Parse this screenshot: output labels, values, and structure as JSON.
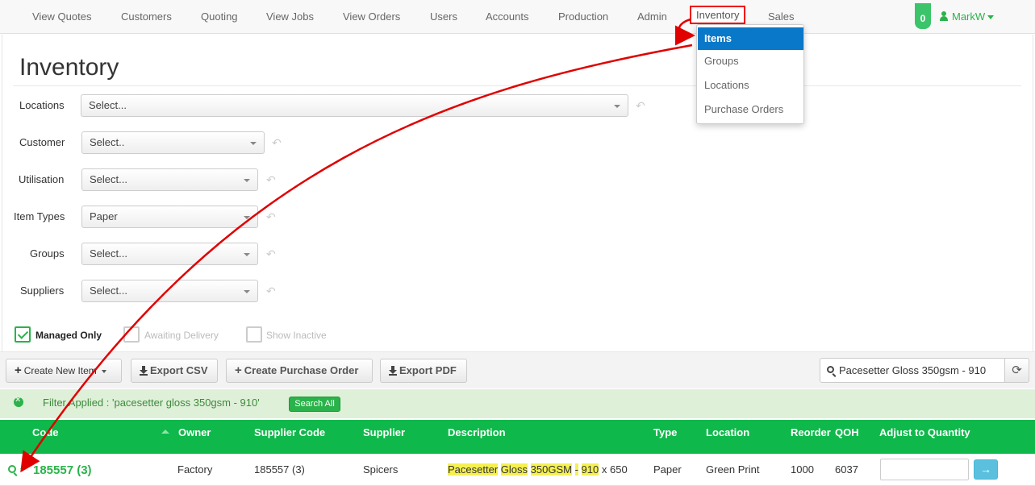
{
  "nav": {
    "items": [
      "View Quotes",
      "Customers",
      "Quoting",
      "View Jobs",
      "View Orders",
      "Users",
      "Accounts",
      "Production",
      "Admin",
      "Inventory",
      "Sales"
    ],
    "notification_count": "0",
    "user_name": "MarkW"
  },
  "dropdown": {
    "items": [
      "Items",
      "Groups",
      "Locations",
      "Purchase Orders"
    ],
    "selected": "Items"
  },
  "page": {
    "title": "Inventory"
  },
  "filters": {
    "locations": {
      "label": "Locations",
      "value": "Select..."
    },
    "customer": {
      "label": "Customer",
      "value": "Select.."
    },
    "utilisation": {
      "label": "Utilisation",
      "value": "Select..."
    },
    "item_types": {
      "label": "Item Types",
      "value": "Paper"
    },
    "groups": {
      "label": "Groups",
      "value": "Select..."
    },
    "suppliers": {
      "label": "Suppliers",
      "value": "Select..."
    }
  },
  "checkboxes": {
    "managed_only": {
      "label": "Managed Only",
      "checked": true
    },
    "awaiting_delivery": {
      "label": "Awaiting Delivery",
      "checked": false
    },
    "show_inactive": {
      "label": "Show Inactive",
      "checked": false
    }
  },
  "toolbar": {
    "create_new_item": "Create New Item",
    "export_csv": "Export CSV",
    "create_purchase_order": "Create Purchase Order",
    "export_pdf": "Export PDF",
    "search_value": "Pacesetter Gloss 350gsm - 910"
  },
  "filter_bar": {
    "text": "Filter Applied : 'pacesetter gloss 350gsm - 910'",
    "search_all": "Search All"
  },
  "table": {
    "headers": [
      "Code",
      "Owner",
      "Supplier Code",
      "Supplier",
      "Description",
      "Type",
      "Location",
      "Reorder",
      "QOH",
      "Adjust to Quantity"
    ],
    "rows": [
      {
        "code": "185557 (3)",
        "owner": "Factory",
        "supplier_code": "185557 (3)",
        "supplier": "Spicers",
        "description_parts": [
          "Pacesetter",
          "Gloss",
          "350GSM",
          "-",
          "910",
          "x 650"
        ],
        "type": "Paper",
        "location": "Green Print",
        "reorder": "1000",
        "qoh": "6037"
      }
    ]
  },
  "colors": {
    "accent_green": "#0fb84a",
    "highlight": "#f5f050",
    "menu_selected": "#0a78c8",
    "annotation": "#e00000"
  }
}
